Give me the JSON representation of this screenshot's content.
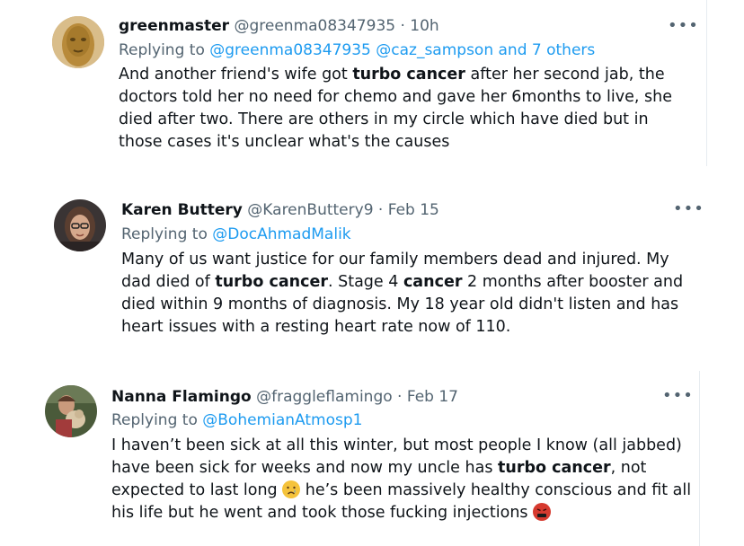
{
  "tweets": [
    {
      "name": "greenmaster",
      "handle": "@greenma08347935",
      "separator": "·",
      "time": "10h",
      "more": "•••",
      "replying_label": "Replying to",
      "replying_to": "@greenma08347935 @caz_sampson and 7 others",
      "body_parts": [
        "And another friend's wife got ",
        "turbo cancer",
        " after her second jab, the doctors told her no need for chemo and gave her 6months to live, she died after two. There are others in my circle which have died but in those cases it's unclear what's the causes"
      ],
      "avatar_icon": "gold-face-mask-avatar"
    },
    {
      "name": "Karen Buttery",
      "handle": "@KarenButtery9",
      "separator": "·",
      "time": "Feb 15",
      "more": "•••",
      "replying_label": "Replying to",
      "replying_to": "@DocAhmadMalik",
      "body_parts": [
        "Many of us want justice for our family members dead and injured. My dad died of ",
        "turbo cancer",
        ". Stage 4 ",
        "cancer",
        " 2 months after booster and died within 9 months of diagnosis.  My 18 year old didn't listen and has heart issues with a resting heart rate now of 110."
      ],
      "avatar_icon": "woman-with-glasses-avatar"
    },
    {
      "name": "Nanna Flamingo",
      "handle": "@fraggleflamingo",
      "separator": "·",
      "time": "Feb 17",
      "more": "•••",
      "replying_label": "Replying to",
      "replying_to": "@BohemianAtmosp1",
      "body_parts": [
        "I haven’t been sick at all this winter, but most people I know (all jabbed) have been sick for weeks and now my uncle has ",
        "turbo cancer",
        ", not expected to last long ",
        " he’s been massively healthy conscious and fit all his life but he went and took those fucking injections "
      ],
      "emojis": [
        "crying-face-emoji",
        "cursing-face-emoji"
      ],
      "avatar_icon": "woman-holding-dog-avatar"
    }
  ],
  "colors": {
    "name": "#0f1419",
    "meta": "#536471",
    "link": "#1d9bf0",
    "divider": "#e6ecf0"
  }
}
